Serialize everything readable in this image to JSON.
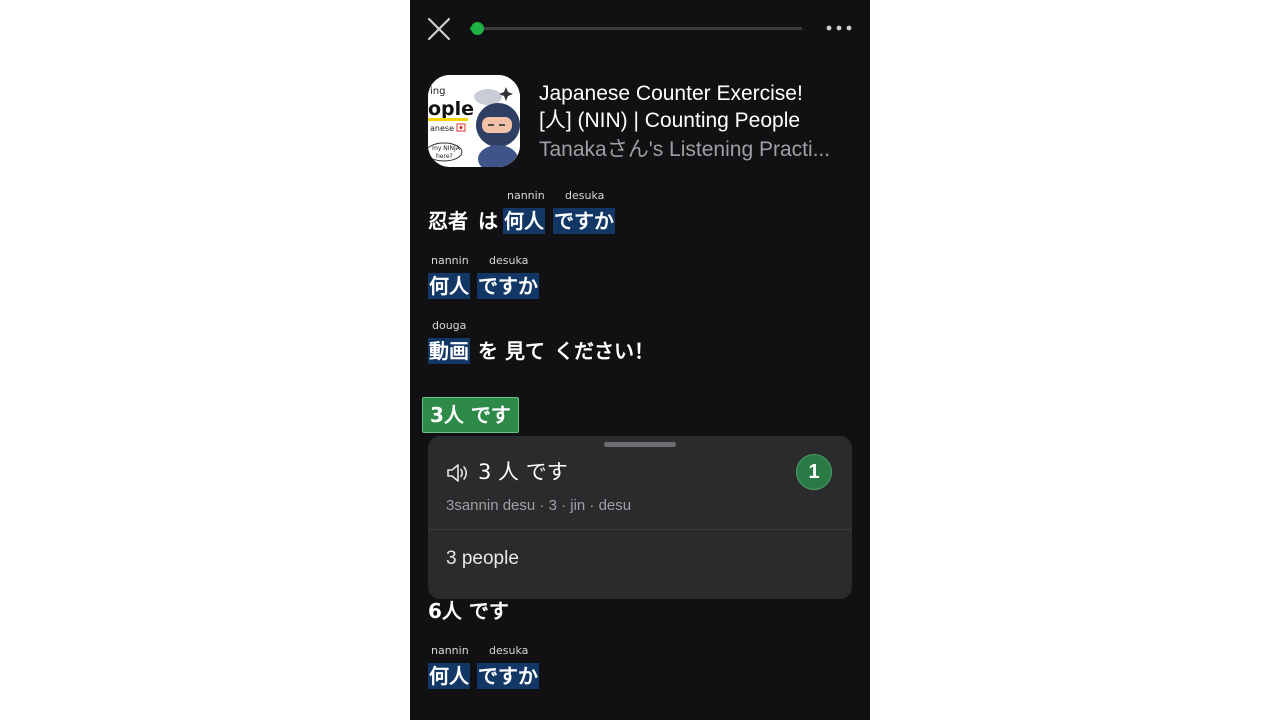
{
  "player": {
    "progress": 0.02,
    "accent_color": "#1fb141",
    "close_icon": "close-icon",
    "more_icon": "more-horizontal-icon"
  },
  "track": {
    "thumbnail_lines": [
      "ing",
      "ople",
      "anese",
      "my NINJA",
      "here?"
    ],
    "title_line1": "Japanese Counter Exercise!",
    "title_line2": "[人] (NIN) | Counting People",
    "subtitle": "Tanakaさん's Listening Practi..."
  },
  "lyrics": {
    "line1": {
      "s1": "忍者",
      "s2": "は",
      "s3": "何人",
      "s4": "ですか",
      "r3": "nannin",
      "r4": "desuka"
    },
    "line2": {
      "s1": "何人",
      "s2": "ですか",
      "r1": "nannin",
      "r2": "desuka"
    },
    "line3": {
      "s1": "動画",
      "s2": "を",
      "s3": "見て",
      "s4": "ください！",
      "r1": "douga"
    },
    "answer": "3人 です",
    "line5": "6人 です",
    "line6": {
      "s1": "何人",
      "s2": "ですか",
      "r1": "nannin",
      "r2": "desuka"
    }
  },
  "popup": {
    "word": "3 人 です",
    "badge": "1",
    "romaji": "3sannin desu · 3 · jin · desu",
    "meaning": "3 people",
    "speaker_icon": "speaker-icon"
  }
}
